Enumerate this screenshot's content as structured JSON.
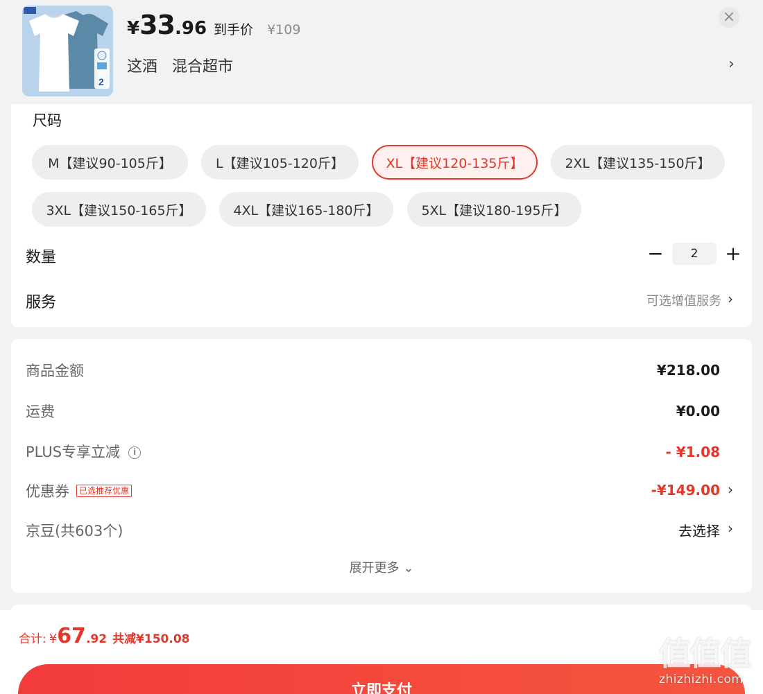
{
  "header": {
    "price_symbol": "¥",
    "price_int": "33",
    "price_dec": ".96",
    "price_tag": "到手价",
    "original_price": "¥109",
    "variant_color": "这酒",
    "variant_type": "混合超市",
    "variant_chevron": "›",
    "close_icon": "×"
  },
  "size": {
    "title": "尺码",
    "options": [
      "M【建议90-105斤】",
      "L【建议105-120斤】",
      "XL【建议120-135斤】",
      "2XL【建议135-150斤】",
      "3XL【建议150-165斤】",
      "4XL【建议165-180斤】",
      "5XL【建议180-195斤】"
    ],
    "selected": "XL【建议120-135斤】"
  },
  "quantity": {
    "label": "数量",
    "minus": "−",
    "value": "2",
    "plus": "+"
  },
  "service": {
    "label": "服务",
    "hint": "可选增值服务",
    "chevron": "›"
  },
  "summary": {
    "goods_label": "商品金额",
    "goods_value": "¥218.00",
    "shipping_label": "运费",
    "shipping_value": "¥0.00",
    "plus_label": "PLUS专享立减",
    "plus_info_icon": "i",
    "plus_value": "- ¥1.08",
    "coupon_label": "优惠券",
    "coupon_badge": "已选推荐优惠",
    "coupon_value": "-¥149.00",
    "coupon_chevron": "›",
    "beans_label": "京豆(共603个)",
    "beans_value": "去选择",
    "beans_chevron": "›",
    "expand_label": "展开更多 ⌄"
  },
  "footer": {
    "total_label": "合计:",
    "total_yen": "¥",
    "total_int": "67",
    "total_dec": ".92",
    "total_saving": "共减¥150.08",
    "pay_button": "立即支付"
  },
  "watermark": {
    "glyphs": "值值值",
    "domain": "zhizhizhi.com"
  },
  "colors": {
    "accent_red": "#e2382b",
    "pay_gradient_start": "#f23b3b",
    "pay_gradient_end": "#f5563f"
  }
}
